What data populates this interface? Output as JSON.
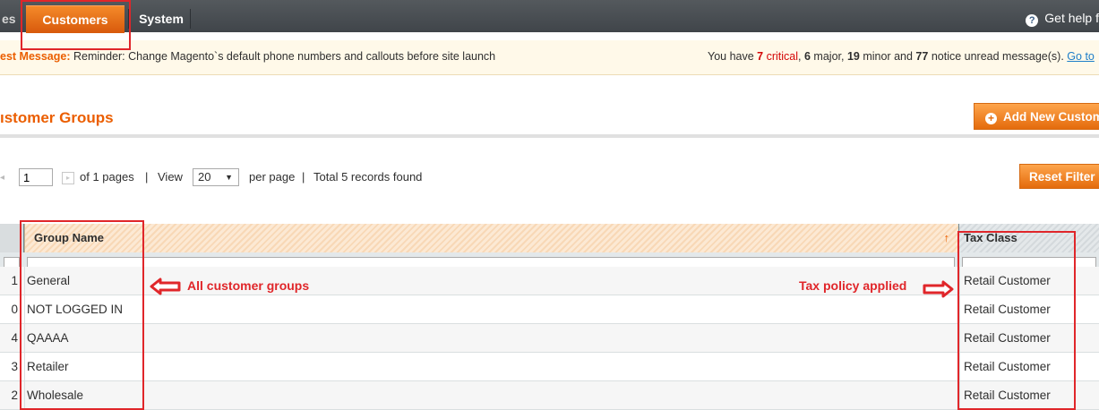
{
  "nav": {
    "items": [
      {
        "label": "es"
      },
      {
        "label": "Customers"
      },
      {
        "label": "System"
      }
    ],
    "help_label": "Get help f"
  },
  "notice": {
    "label": "est Message:",
    "text": "Reminder: Change Magento`s default phone numbers and callouts before site launch",
    "you_have": "You have",
    "critical_count": "7",
    "critical_label": "critical",
    "major_count": "6",
    "major_label": "major,",
    "minor_count": "19",
    "minor_label": "minor and",
    "notice_count": "77",
    "notice_label": "notice unread message(s).",
    "goto_label": "Go to"
  },
  "page": {
    "title": "ıstomer Groups",
    "add_button_label": "Add New Custom"
  },
  "pager": {
    "page_value": "1",
    "of_pages": "of 1 pages",
    "sep1": "|",
    "view_label": "View",
    "per_page_value": "20",
    "per_page_label": "per page",
    "sep2": "|",
    "total_label": "Total 5 records found",
    "reset_label": "Reset Filter"
  },
  "grid": {
    "columns": {
      "name": "Group Name",
      "tax": "Tax Class"
    },
    "rows": [
      {
        "id": "1",
        "name": "General",
        "tax": "Retail Customer"
      },
      {
        "id": "0",
        "name": "NOT LOGGED IN",
        "tax": "Retail Customer"
      },
      {
        "id": "4",
        "name": "QAAAA",
        "tax": "Retail Customer"
      },
      {
        "id": "3",
        "name": "Retailer",
        "tax": "Retail Customer"
      },
      {
        "id": "2",
        "name": "Wholesale",
        "tax": "Retail Customer"
      }
    ]
  },
  "annotations": {
    "left_text": "All customer groups",
    "right_text": "Tax policy applied"
  },
  "colors": {
    "accent": "#eb5e00",
    "annotation_red": "#e0262a",
    "nav_bg": "#40454a"
  }
}
